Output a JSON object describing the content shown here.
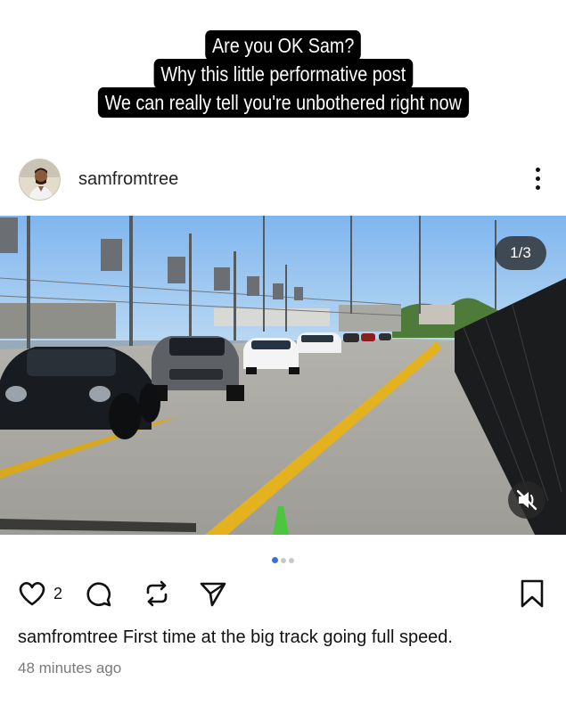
{
  "overlay": {
    "lines": [
      "Are you OK Sam?",
      "Why this little performative post",
      "We can really tell you're unbothered right now"
    ]
  },
  "post": {
    "username": "samfromtree",
    "image_counter": "1/3",
    "likes": "2",
    "caption": "First time at the big track going full speed.",
    "timestamp": "48 minutes ago",
    "carousel": {
      "count": 3,
      "active_index": 0
    }
  },
  "icons": {
    "more": "more-vertical-icon",
    "like": "heart-icon",
    "comment": "comment-bubble-icon",
    "repost": "repost-icon",
    "share": "send-icon",
    "save": "bookmark-icon",
    "mute": "speaker-muted-icon"
  },
  "colors": {
    "accent": "#3b6fe0",
    "overlay_bg": "#000000",
    "text_secondary": "#7a7a7a"
  }
}
